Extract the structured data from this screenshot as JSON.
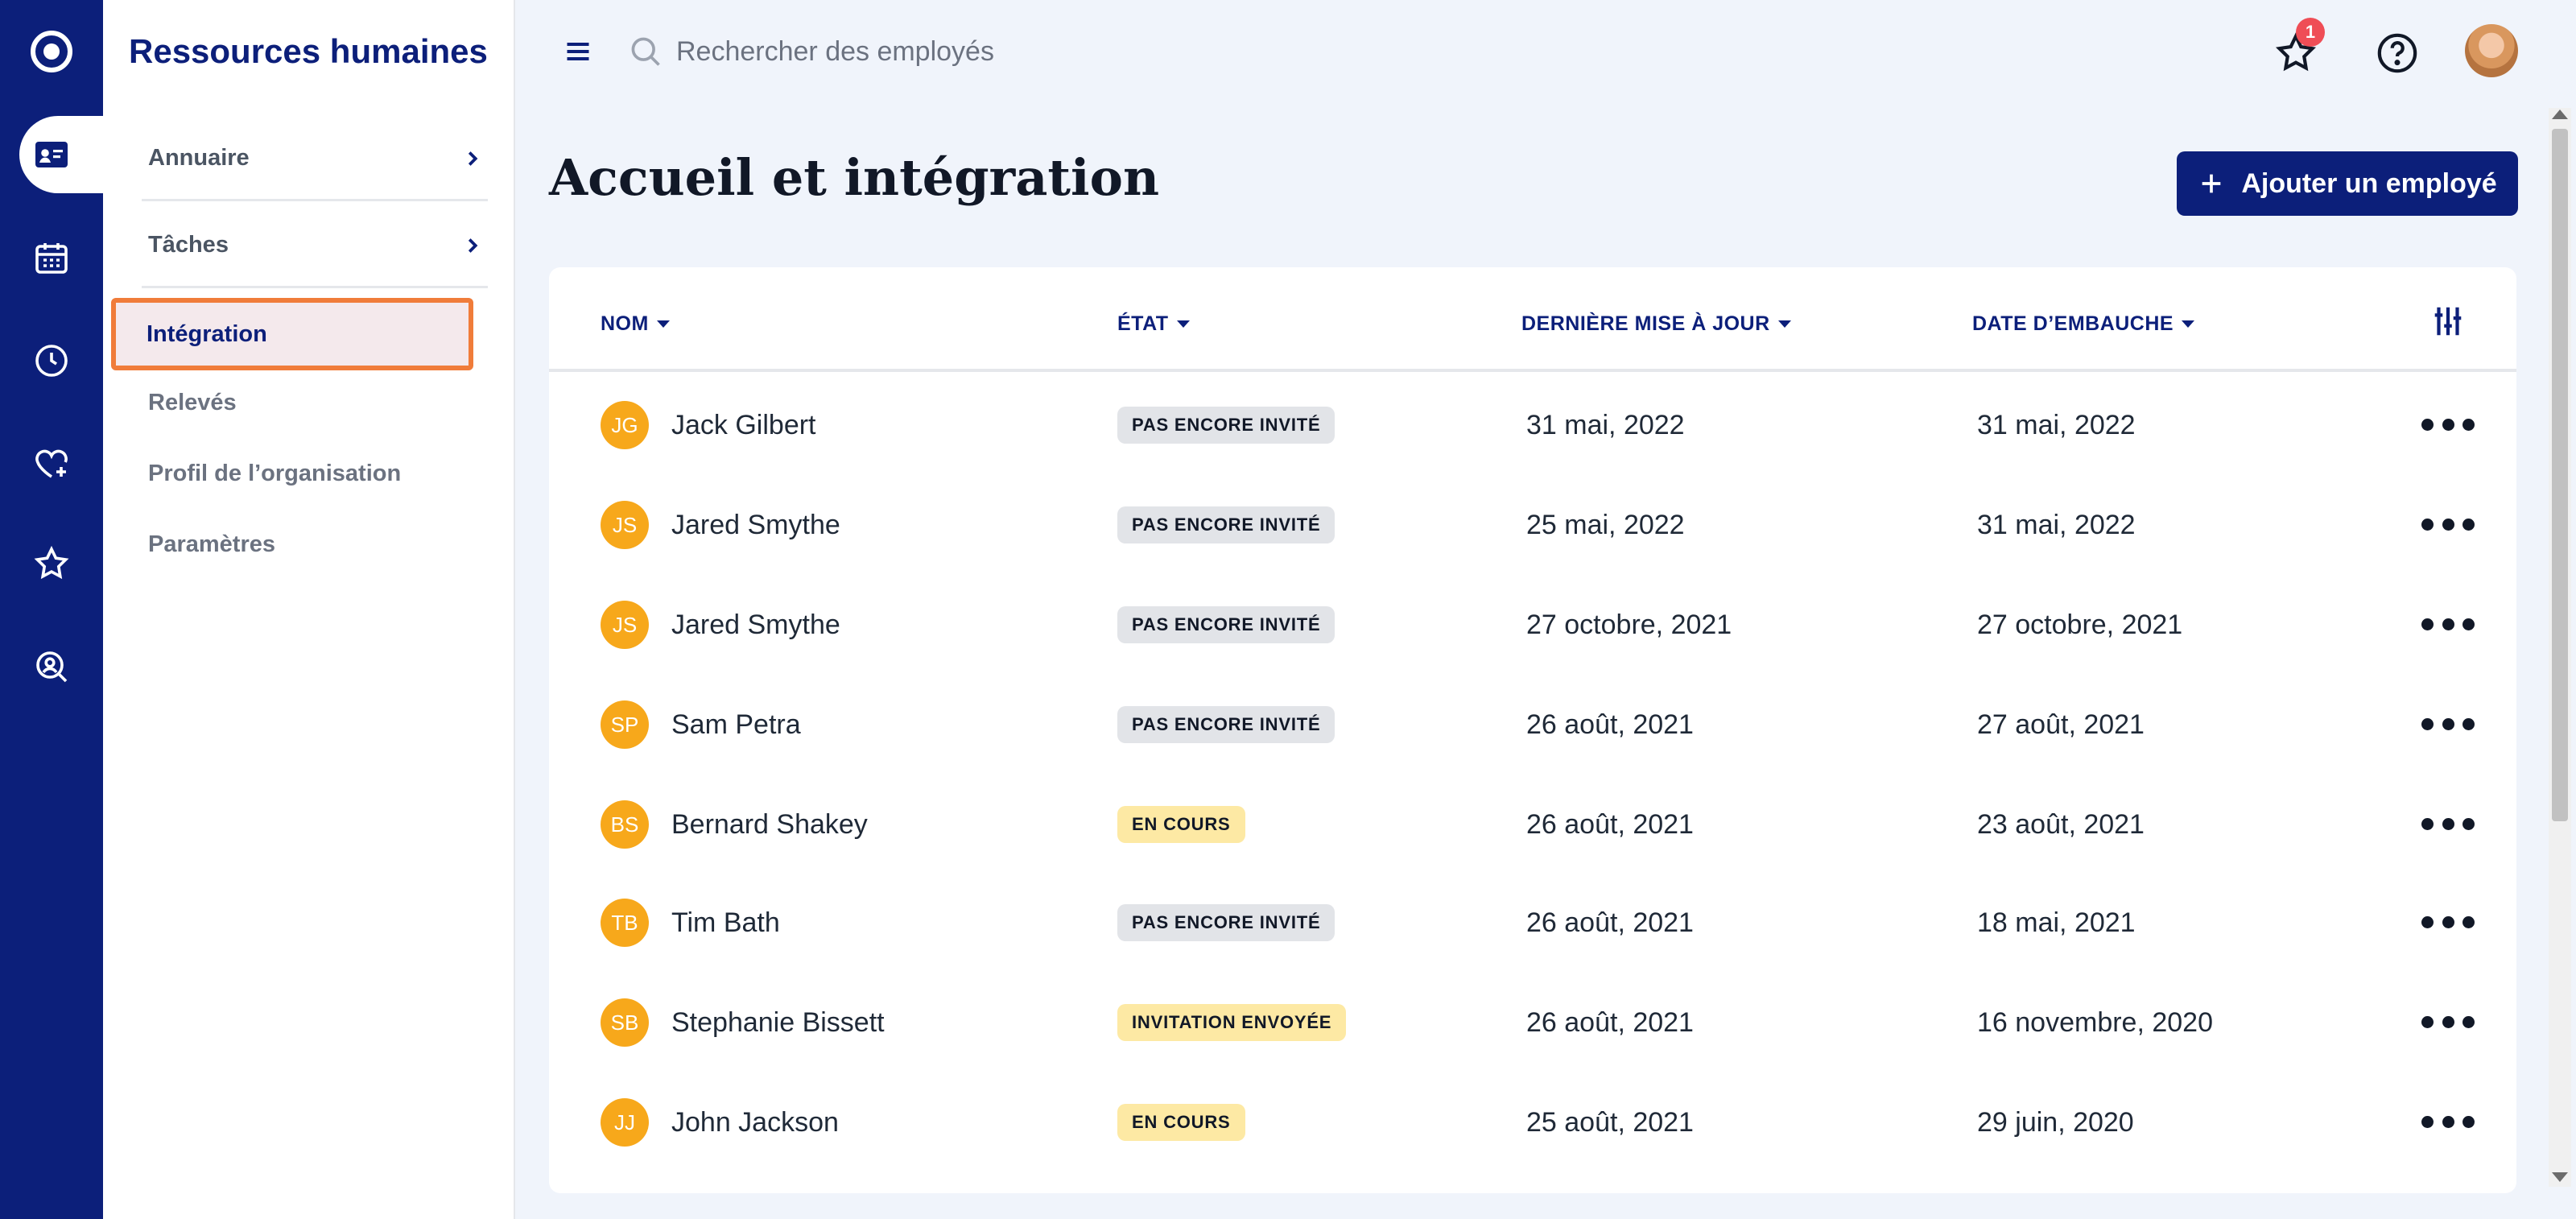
{
  "colors": {
    "brand": "#0c1f7a",
    "accent": "#f07c3a",
    "avatar": "#f7a81b",
    "badge": "#ef4d56"
  },
  "rail": {
    "items": [
      {
        "icon": "id-card-icon",
        "active": true
      },
      {
        "icon": "calendar-icon",
        "active": false
      },
      {
        "icon": "clock-icon",
        "active": false
      },
      {
        "icon": "heart-plus-icon",
        "active": false
      },
      {
        "icon": "star-icon",
        "active": false
      },
      {
        "icon": "user-search-icon",
        "active": false
      }
    ]
  },
  "sidebar": {
    "title": "Ressources humaines",
    "items": [
      {
        "label": "Annuaire",
        "has_chevron": true
      },
      {
        "label": "Tâches",
        "has_chevron": true
      },
      {
        "label": "Intégration",
        "active": true
      },
      {
        "label": "Relevés"
      },
      {
        "label": "Profil de l’organisation"
      },
      {
        "label": "Paramètres"
      }
    ]
  },
  "header": {
    "search_placeholder": "Rechercher des employés",
    "notification_count": "1"
  },
  "page": {
    "title": "Accueil et intégration",
    "add_button": "Ajouter un employé"
  },
  "table": {
    "columns": [
      "NOM",
      "ÉTAT",
      "DERNIÈRE MISE À JOUR",
      "DATE D’EMBAUCHE"
    ],
    "rows": [
      {
        "initials": "JG",
        "name": "Jack Gilbert",
        "status": "PAS ENCORE INVITÉ",
        "status_color": "gray",
        "updated": "31 mai, 2022",
        "hired": "31 mai, 2022"
      },
      {
        "initials": "JS",
        "name": "Jared Smythe",
        "status": "PAS ENCORE INVITÉ",
        "status_color": "gray",
        "updated": "25 mai, 2022",
        "hired": "31 mai, 2022"
      },
      {
        "initials": "JS",
        "name": "Jared Smythe",
        "status": "PAS ENCORE INVITÉ",
        "status_color": "gray",
        "updated": "27 octobre, 2021",
        "hired": "27 octobre, 2021"
      },
      {
        "initials": "SP",
        "name": "Sam Petra",
        "status": "PAS ENCORE INVITÉ",
        "status_color": "gray",
        "updated": "26 août, 2021",
        "hired": "27 août, 2021"
      },
      {
        "initials": "BS",
        "name": "Bernard Shakey",
        "status": "EN COURS",
        "status_color": "yellow",
        "updated": "26 août, 2021",
        "hired": "23 août, 2021"
      },
      {
        "initials": "TB",
        "name": "Tim Bath",
        "status": "PAS ENCORE INVITÉ",
        "status_color": "gray",
        "updated": "26 août, 2021",
        "hired": "18 mai, 2021"
      },
      {
        "initials": "SB",
        "name": "Stephanie Bissett",
        "status": "INVITATION ENVOYÉE",
        "status_color": "yellow",
        "updated": "26 août, 2021",
        "hired": "16 novembre, 2020"
      },
      {
        "initials": "JJ",
        "name": "John Jackson",
        "status": "EN COURS",
        "status_color": "yellow",
        "updated": "25 août, 2021",
        "hired": "29 juin, 2020"
      }
    ]
  }
}
